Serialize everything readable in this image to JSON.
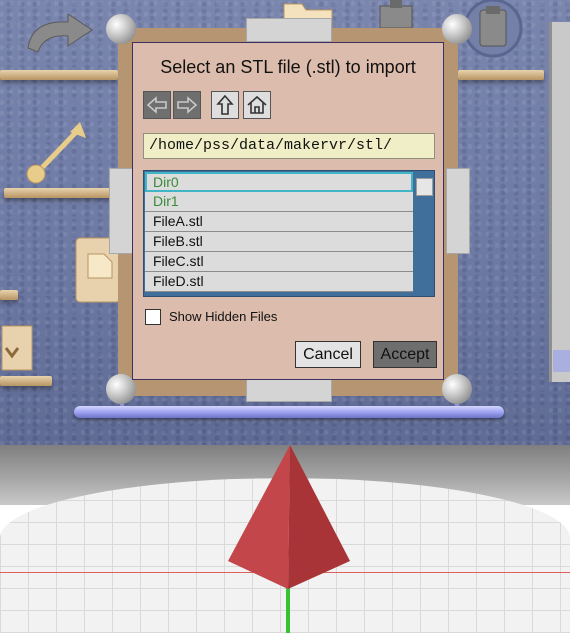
{
  "dialog": {
    "title": "Select an STL file (.stl) to import",
    "nav": {
      "back_icon": "left-arrow-icon",
      "forward_icon": "right-arrow-icon",
      "up_icon": "up-arrow-icon",
      "home_icon": "home-icon"
    },
    "path": "/home/pss/data/makervr/stl/",
    "files": [
      {
        "name": "Dir0",
        "type": "dir",
        "selected": true
      },
      {
        "name": "Dir1",
        "type": "dir",
        "selected": false
      },
      {
        "name": "FileA.stl",
        "type": "file",
        "selected": false
      },
      {
        "name": "FileB.stl",
        "type": "file",
        "selected": false
      },
      {
        "name": "FileC.stl",
        "type": "file",
        "selected": false
      },
      {
        "name": "FileD.stl",
        "type": "file",
        "selected": false
      }
    ],
    "show_hidden_label": "Show Hidden Files",
    "show_hidden_checked": false,
    "cancel_label": "Cancel",
    "accept_label": "Accept"
  },
  "colors": {
    "dialog_bg": "#dcbcac",
    "directory_text": "#3c8a3c",
    "selection_border": "#3fb5c6",
    "list_bg": "#3f6f9a",
    "path_bg": "#efeec6"
  }
}
